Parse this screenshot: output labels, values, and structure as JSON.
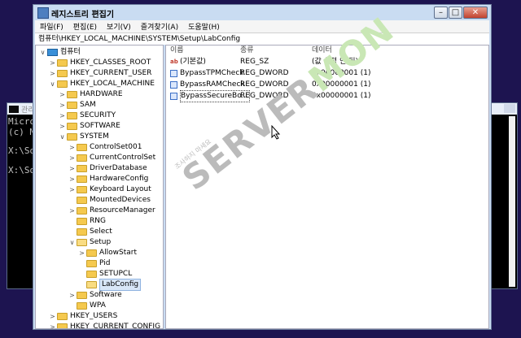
{
  "console_left": {
    "title": "관리",
    "lines": [
      "Micros",
      "(c) M",
      "X:\\Sou",
      "X:\\Sou"
    ]
  },
  "console_right": {
    "title": ""
  },
  "window": {
    "title": "레지스트리 편집기",
    "buttons": {
      "minimize": "–",
      "maximize": "□",
      "close": "✕"
    }
  },
  "menu": [
    "파일(F)",
    "편집(E)",
    "보기(V)",
    "즐겨찾기(A)",
    "도움말(H)"
  ],
  "address": "컴퓨터\\HKEY_LOCAL_MACHINE\\SYSTEM\\Setup\\LabConfig",
  "tree": [
    {
      "label": "컴퓨터",
      "level": 0,
      "exp": "∨",
      "type": "pc"
    },
    {
      "label": "HKEY_CLASSES_ROOT",
      "level": 1,
      "exp": ">",
      "type": "folder"
    },
    {
      "label": "HKEY_CURRENT_USER",
      "level": 1,
      "exp": ">",
      "type": "folder"
    },
    {
      "label": "HKEY_LOCAL_MACHINE",
      "level": 1,
      "exp": "∨",
      "type": "folder"
    },
    {
      "label": "HARDWARE",
      "level": 2,
      "exp": ">",
      "type": "folder"
    },
    {
      "label": "SAM",
      "level": 2,
      "exp": ">",
      "type": "folder"
    },
    {
      "label": "SECURITY",
      "level": 2,
      "exp": ">",
      "type": "folder"
    },
    {
      "label": "SOFTWARE",
      "level": 2,
      "exp": ">",
      "type": "folder"
    },
    {
      "label": "SYSTEM",
      "level": 2,
      "exp": "∨",
      "type": "folder"
    },
    {
      "label": "ControlSet001",
      "level": 3,
      "exp": ">",
      "type": "folder"
    },
    {
      "label": "CurrentControlSet",
      "level": 3,
      "exp": ">",
      "type": "folder"
    },
    {
      "label": "DriverDatabase",
      "level": 3,
      "exp": ">",
      "type": "folder"
    },
    {
      "label": "HardwareConfig",
      "level": 3,
      "exp": ">",
      "type": "folder"
    },
    {
      "label": "Keyboard Layout",
      "level": 3,
      "exp": ">",
      "type": "folder"
    },
    {
      "label": "MountedDevices",
      "level": 3,
      "exp": "",
      "type": "folder"
    },
    {
      "label": "ResourceManager",
      "level": 3,
      "exp": ">",
      "type": "folder"
    },
    {
      "label": "RNG",
      "level": 3,
      "exp": "",
      "type": "folder"
    },
    {
      "label": "Select",
      "level": 3,
      "exp": "",
      "type": "folder"
    },
    {
      "label": "Setup",
      "level": 3,
      "exp": "∨",
      "type": "folder-open"
    },
    {
      "label": "AllowStart",
      "level": 4,
      "exp": ">",
      "type": "folder"
    },
    {
      "label": "Pid",
      "level": 4,
      "exp": "",
      "type": "folder"
    },
    {
      "label": "SETUPCL",
      "level": 4,
      "exp": "",
      "type": "folder"
    },
    {
      "label": "LabConfig",
      "level": 4,
      "exp": "",
      "type": "folder-open",
      "selected": true
    },
    {
      "label": "Software",
      "level": 3,
      "exp": ">",
      "type": "folder"
    },
    {
      "label": "WPA",
      "level": 3,
      "exp": "",
      "type": "folder"
    },
    {
      "label": "HKEY_USERS",
      "level": 1,
      "exp": ">",
      "type": "folder"
    },
    {
      "label": "HKEY_CURRENT_CONFIG",
      "level": 1,
      "exp": ">",
      "type": "folder"
    }
  ],
  "list_headers": {
    "name": "이름",
    "type": "종류",
    "data": "데이터"
  },
  "values": [
    {
      "name": "(기본값)",
      "type": "REG_SZ",
      "data": "(값 설정 안 됨)",
      "icon": "string-value-icon"
    },
    {
      "name": "BypassTPMCheck",
      "type": "REG_DWORD",
      "data": "0x00000001 (1)",
      "icon": "binary-value-icon"
    },
    {
      "name": "BypassRAMCheck",
      "type": "REG_DWORD",
      "data": "0x00000001 (1)",
      "icon": "binary-value-icon"
    },
    {
      "name": "BypassSecureBo...",
      "type": "REG_DWORD",
      "data": "0x00000001 (1)",
      "icon": "binary-value-icon",
      "focused": true
    }
  ],
  "watermark": {
    "main_a": "SERVER",
    "main_b": "MON",
    "sub": "조사하지 마세요",
    "color_a": "#bbbbbb",
    "color_b": "#c9e7b5"
  }
}
